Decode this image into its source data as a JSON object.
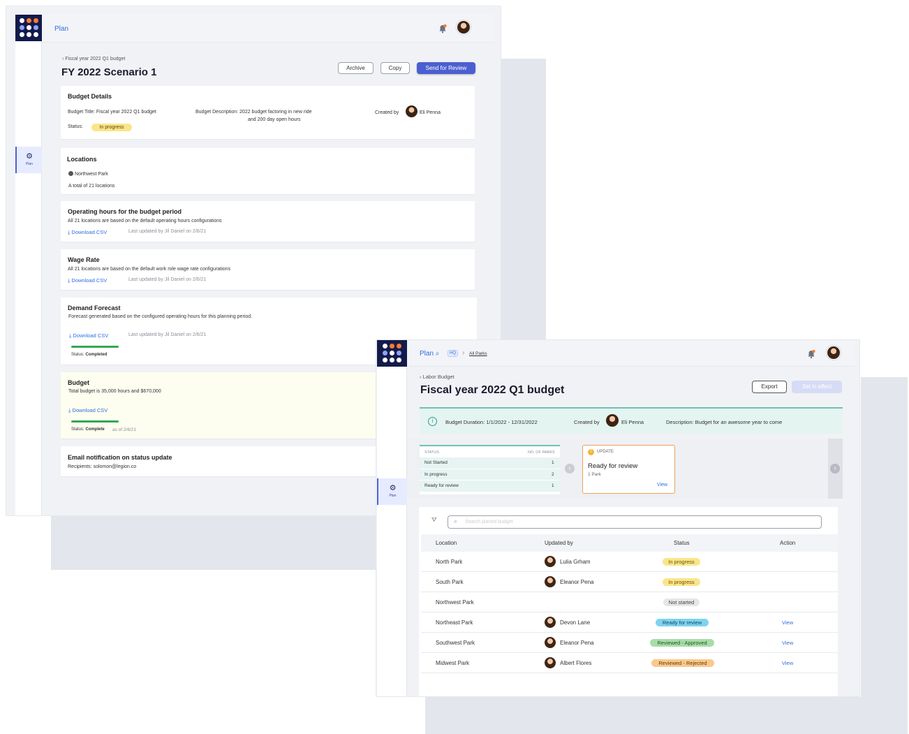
{
  "window1": {
    "nav_title": "Plan",
    "side_label": "Plan",
    "breadcrumb": "Fiscal year 2022 Q1 budget",
    "page_title": "FY 2022 Scenario 1",
    "buttons": {
      "archive": "Archive",
      "copy": "Copy",
      "send": "Send for Review"
    },
    "budget_details": {
      "title": "Budget Details",
      "budget_title": "Budget Title: Fiscal year 2022 Q1 budget",
      "description_line1": "Budget Description: 2022 budget factoring in new ride",
      "description_line2": "and 200 day open hours",
      "created_by_label": "Created by",
      "created_by_name": "Eli Penna",
      "status_label": "Status:",
      "status_value": "In progress"
    },
    "locations": {
      "title": "Locations",
      "item": "Northwest Park",
      "total": "A total of 21 locations"
    },
    "operating_hours": {
      "title": "Operating hours for the budget period",
      "text": "All 21 locations are based on the default operating hours configurations",
      "download": "Download CSV",
      "updated": "Last updated by Jil Daniel on 2/6/21"
    },
    "wage_rate": {
      "title": "Wage Rate",
      "text": "All 21 locations are based on the default work role wage rate configurations",
      "download": "Download CSV",
      "updated": "Last updated by Jil Daniel on 2/6/21"
    },
    "demand_forecast": {
      "title": "Demand Forecast",
      "text": "Forecast generated based on the configured operating hours for this planning period.",
      "download": "Download CSV",
      "updated": "Last updated by Jil Daniel on 2/6/21",
      "status_label": "Status:",
      "status_value": "Completed",
      "progress": 1.0
    },
    "budget": {
      "title": "Budget",
      "text": "Total budget is 35,000 hours and $670,000",
      "download": "Download CSV",
      "status_label": "Status:",
      "status_value": "Complete",
      "as_of": "as of 2/6/21",
      "progress": 1.0
    },
    "email": {
      "title": "Email notification on status update",
      "recipients": "Recipients: solomon@legion.co"
    }
  },
  "window2": {
    "nav_title": "Plan",
    "hq": "HQ",
    "all_parks": "All Parks",
    "side_label": "Plan",
    "breadcrumb": "Labor Budget",
    "page_title": "Fiscal year 2022 Q1 budget",
    "buttons": {
      "export": "Export",
      "set_in_effect": "Set in effect"
    },
    "banner": {
      "duration": "Budget Duration: 1/1/2022 - 12/31/2022",
      "created_by_label": "Created by",
      "created_by_name": "Eli Penna",
      "description": "Description: Budget for an awesome year to come"
    },
    "status_table": {
      "col_status": "STATUS",
      "col_parks": "NO. OF PARKS",
      "rows": [
        {
          "status": "Not Started",
          "count": "1"
        },
        {
          "status": "In progress",
          "count": "2"
        },
        {
          "status": "Ready for review",
          "count": "1"
        }
      ]
    },
    "update_card": {
      "label": "UPDATE",
      "title": "Ready for review",
      "sub": "1 Park",
      "link": "View"
    },
    "search_placeholder": "Search planed budget",
    "table": {
      "headers": {
        "location": "Location",
        "updated_by": "Updated by",
        "status": "Status",
        "action": "Action"
      },
      "rows": [
        {
          "location": "North Park",
          "updated_by": "Lulia Grham",
          "status": "In progress",
          "status_kind": "yellow",
          "action": ""
        },
        {
          "location": "South Park",
          "updated_by": "Eleanor Pena",
          "status": "In progress",
          "status_kind": "yellow",
          "action": ""
        },
        {
          "location": "Northwest Park",
          "updated_by": "",
          "status": "Not started",
          "status_kind": "gray",
          "action": ""
        },
        {
          "location": "Northeast Park",
          "updated_by": "Devon Lane",
          "status": "Ready for review",
          "status_kind": "blue",
          "action": "View"
        },
        {
          "location": "Southwest Park",
          "updated_by": "Eleanor Pena",
          "status": "Reviewed - Approved",
          "status_kind": "green",
          "action": "View"
        },
        {
          "location": "Midwest Park",
          "updated_by": "Albert Flores",
          "status": "Reviewed - Rejected",
          "status_kind": "orange",
          "action": "View"
        }
      ]
    }
  },
  "colors": {
    "brand_navy": "#131b4b",
    "primary": "#4b5fd1",
    "link": "#2e6ee0",
    "status_yellow": "#fbe58a",
    "status_blue": "#7fd3ee",
    "status_green": "#a8dca8",
    "status_orange": "#f9c88c",
    "status_gray": "#e6e6e6"
  }
}
